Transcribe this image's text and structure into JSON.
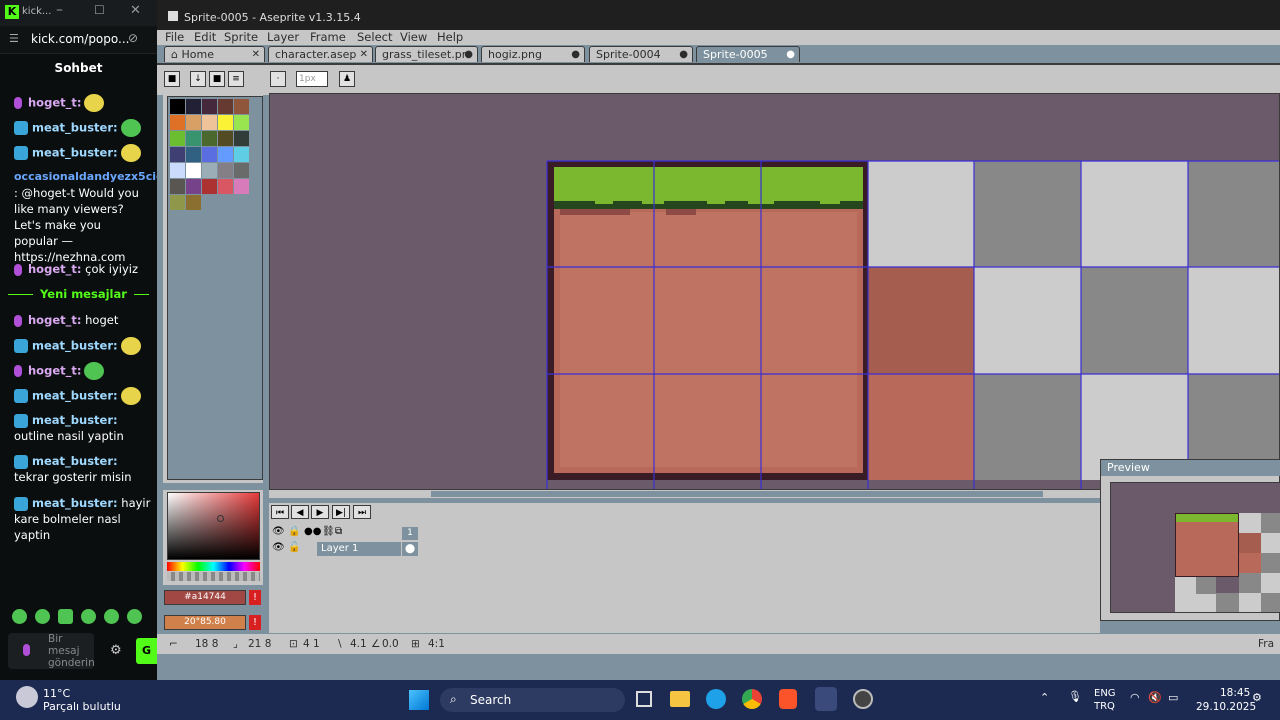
{
  "kick": {
    "window_title": "kick...",
    "url": "kick.com/popo...",
    "chat_header": "Sohbet",
    "messages": [
      {
        "user": "hoget_t:",
        "text": ""
      },
      {
        "user": "meat_buster:",
        "text": ""
      },
      {
        "user": "meat_buster:",
        "text": ""
      },
      {
        "user": "occasionaldandyezx5ciqw",
        "text": ": @hoget-t Would you like many viewers? Let's make you popular — https://nezhna.com"
      },
      {
        "user": "hoget_t:",
        "text": "çok iyiyiz"
      }
    ],
    "new_messages_label": "Yeni mesajlar",
    "new_messages": [
      {
        "user": "hoget_t:",
        "text": "hoget"
      },
      {
        "user": "meat_buster:",
        "text": ""
      },
      {
        "user": "hoget_t:",
        "text": ""
      },
      {
        "user": "meat_buster:",
        "text": ""
      },
      {
        "user": "meat_buster:",
        "text": "outline nasil yaptin"
      },
      {
        "user": "meat_buster:",
        "text": "tekrar gosterir misin"
      },
      {
        "user": "meat_buster:",
        "text": "hayir kare bolmeler nasl yaptin"
      }
    ],
    "input_placeholder": "Bir mesaj gönderin"
  },
  "aseprite": {
    "title": "Sprite-0005 - Aseprite v1.3.15.4",
    "menu": [
      "File",
      "Edit",
      "Sprite",
      "Layer",
      "Frame",
      "Select",
      "View",
      "Help"
    ],
    "tabs": [
      {
        "label": "Home",
        "active": false
      },
      {
        "label": "character.asep",
        "active": false
      },
      {
        "label": "grass_tileset.pr",
        "active": false
      },
      {
        "label": "hogiz.png",
        "active": false
      },
      {
        "label": "Sprite-0004",
        "active": false
      },
      {
        "label": "Sprite-0005",
        "active": true
      }
    ],
    "zoom_field": "1px",
    "fg_color_label": "#a14744",
    "bg_color_label": "20°85.80",
    "timeline": {
      "frame_number": "1",
      "layer_name": "Layer 1"
    },
    "status": {
      "pos": "18 8",
      "size": "21 8",
      "grid": "4 1",
      "offset": "4.1",
      "angle": "0.0",
      "ratio": "4:1",
      "right": "Fra"
    },
    "preview_title": "Preview"
  },
  "taskbar": {
    "weather_temp": "11°C",
    "weather_desc": "Parçalı bulutlu",
    "search": "Search",
    "lang1": "ENG",
    "lang2": "TRQ",
    "time": "18:45",
    "date": "29.10.2025"
  },
  "colors": {
    "grass": "#7cb82f",
    "dirt": "#b8695a",
    "dirt_light": "#c98470",
    "grid_line": "#3b2fd4",
    "canvas_bg": "#6a5a6a"
  }
}
